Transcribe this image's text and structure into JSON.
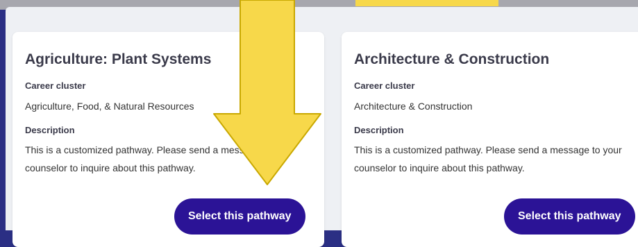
{
  "colors": {
    "accent_yellow": "#f7d84a",
    "button_purple": "#2b1396",
    "border_navy": "#2b2f84",
    "card_bg": "#ffffff",
    "panel_bg": "#eef0f4"
  },
  "cards": [
    {
      "title": "Agriculture: Plant Systems",
      "cluster_label": "Career cluster",
      "cluster_value": "Agriculture, Food, & Natural Resources",
      "description_label": "Description",
      "description_line_1": "This is a customized pathway. Please send a message to your",
      "description_line_2": "counselor to inquire about this pathway.",
      "button_label": "Select this pathway"
    },
    {
      "title": "Architecture & Construction",
      "cluster_label": "Career cluster",
      "cluster_value": "Architecture & Construction",
      "description_label": "Description",
      "description_line_1": "This is a customized pathway. Please send a message to your",
      "description_line_2": "counselor to inquire about this pathway.",
      "button_label": "Select this pathway"
    }
  ],
  "overlay": {
    "icon": "down-arrow-icon",
    "color": "#f7d84a"
  }
}
